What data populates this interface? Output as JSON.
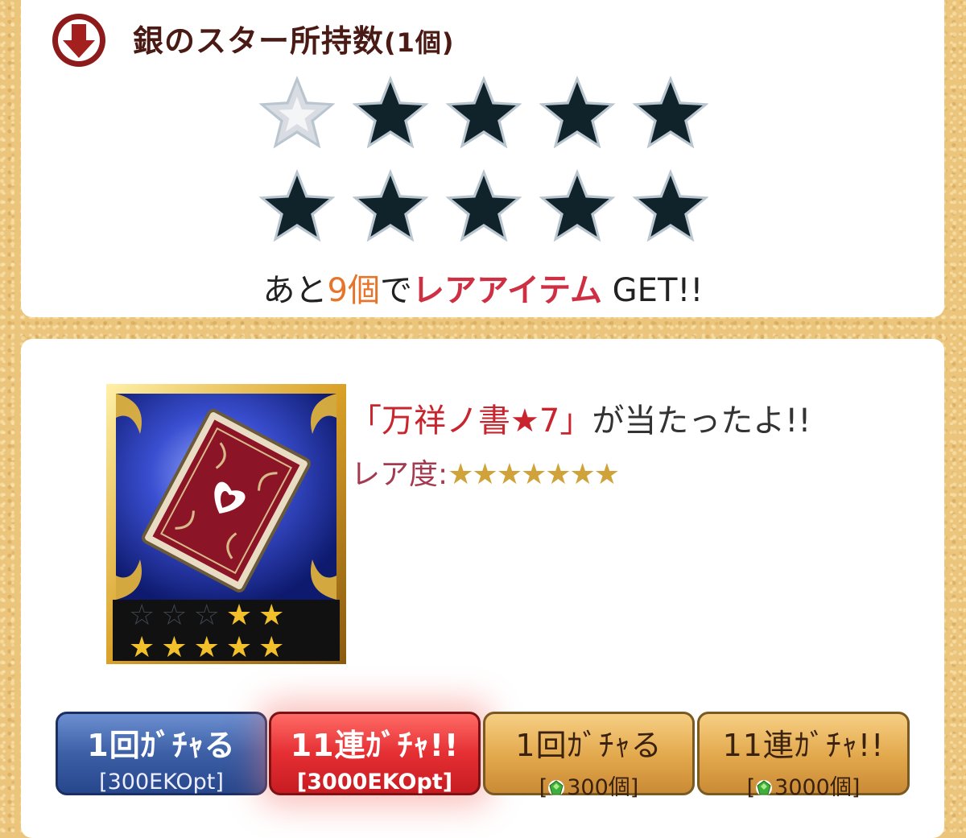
{
  "header": {
    "icon": "down-arrow-icon",
    "title": "銀のスター所持数",
    "count": "(1個)"
  },
  "silver_stars": {
    "total": 10,
    "collected": 1,
    "colors": {
      "collected": "#d9dde3",
      "empty": "#10232a",
      "outline": "#b9c6cf"
    }
  },
  "progress": {
    "prefix": "あと",
    "number": "9個",
    "middle": "で",
    "highlight": "レアアイテム",
    "suffix": " GET!!"
  },
  "result": {
    "item_icon": "book-card-icon",
    "open_bracket": "「",
    "item_name": "万祥ノ書★7",
    "close_bracket": "」",
    "message": "が当たったよ!!",
    "rarity_label": "レア度:",
    "rarity_stars": "★★★★★★★"
  },
  "card": {
    "stars_top": [
      "☆",
      "☆",
      "☆",
      "★",
      "★"
    ],
    "stars_bottom": [
      "★",
      "★",
      "★",
      "★",
      "★"
    ]
  },
  "buttons": [
    {
      "label": "1回ｶﾞﾁｬる",
      "cost": "[300EKOpt]",
      "style": "blue"
    },
    {
      "label": "11連ｶﾞﾁｬ!!",
      "cost": "[3000EKOpt]",
      "style": "red"
    },
    {
      "label": "1回ｶﾞﾁｬる",
      "cost_open": "[",
      "cost": "300個]",
      "style": "gold",
      "icon": "gem-icon"
    },
    {
      "label": "11連ｶﾞﾁｬ!!",
      "cost_open": "[",
      "cost": "3000個]",
      "style": "gold",
      "icon": "gem-icon"
    }
  ],
  "colors": {
    "accent_red": "#cf2f42",
    "accent_orange": "#e8742a",
    "title_brown": "#4a1a14",
    "rarity_gold": "#cfa33a"
  }
}
